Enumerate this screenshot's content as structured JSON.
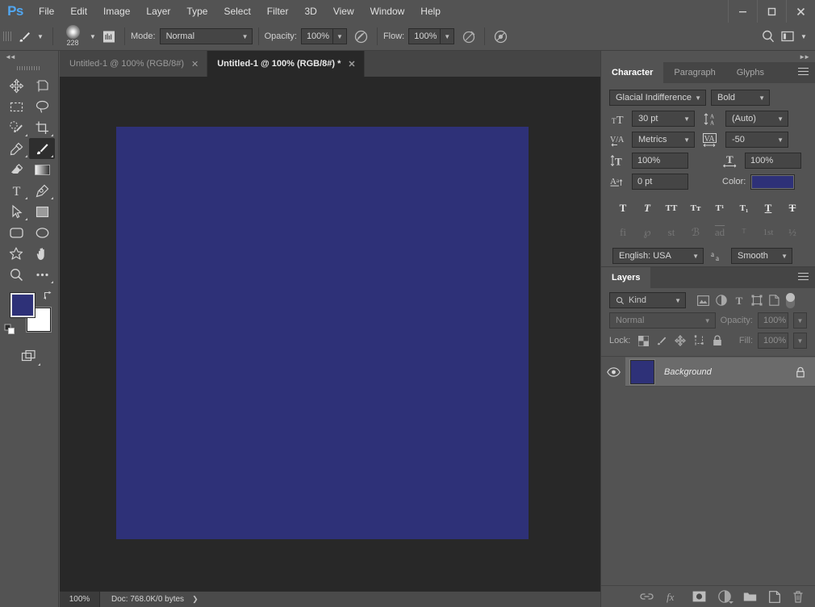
{
  "app": {
    "name": "Ps",
    "logo_color": "#51a6f0"
  },
  "menubar": {
    "items": [
      "File",
      "Edit",
      "Image",
      "Layer",
      "Type",
      "Select",
      "Filter",
      "3D",
      "View",
      "Window",
      "Help"
    ]
  },
  "window_controls": {
    "minimize": "minimize-icon",
    "maximize": "maximize-icon",
    "close": "close-icon"
  },
  "options_bar": {
    "tool_icon": "brush-tool-icon",
    "brush_size": "228",
    "brush_settings_icon": "brush-panel-icon",
    "mode_label": "Mode:",
    "mode_value": "Normal",
    "opacity_label": "Opacity:",
    "opacity_value": "100%",
    "airbrush_opacity_icon": "pressure-opacity-icon",
    "flow_label": "Flow:",
    "flow_value": "100%",
    "airbrush_icon": "airbrush-icon",
    "smoothing_icon": "pressure-size-icon",
    "search_icon": "search-icon",
    "workspace_icon": "workspace-icon"
  },
  "toolbar": {
    "collapse_icon": "collapse-panel-icon",
    "tools": [
      {
        "name": "move-tool",
        "active": false,
        "has_flyout": false
      },
      {
        "name": "artboard-tool",
        "active": false,
        "has_flyout": false
      },
      {
        "name": "rectangular-marquee-tool",
        "active": false,
        "has_flyout": false
      },
      {
        "name": "lasso-tool",
        "active": false,
        "has_flyout": false
      },
      {
        "name": "quick-selection-tool",
        "active": false,
        "has_flyout": true
      },
      {
        "name": "crop-tool",
        "active": false,
        "has_flyout": true
      },
      {
        "name": "eyedropper-tool",
        "active": false,
        "has_flyout": true
      },
      {
        "name": "brush-tool",
        "active": true,
        "has_flyout": true
      },
      {
        "name": "eraser-tool",
        "active": false,
        "has_flyout": false
      },
      {
        "name": "gradient-tool",
        "active": false,
        "has_flyout": false
      },
      {
        "name": "type-tool",
        "active": false,
        "has_flyout": true
      },
      {
        "name": "pen-tool",
        "active": false,
        "has_flyout": true
      },
      {
        "name": "path-selection-tool",
        "active": false,
        "has_flyout": true
      },
      {
        "name": "rectangle-shape-tool",
        "active": false,
        "has_flyout": false
      },
      {
        "name": "rounded-rectangle-tool",
        "active": false,
        "has_flyout": false
      },
      {
        "name": "ellipse-tool",
        "active": false,
        "has_flyout": false
      },
      {
        "name": "custom-shape-tool",
        "active": false,
        "has_flyout": false
      },
      {
        "name": "hand-tool",
        "active": false,
        "has_flyout": false
      },
      {
        "name": "zoom-tool",
        "active": false,
        "has_flyout": false
      },
      {
        "name": "edit-toolbar-tool",
        "active": false,
        "has_flyout": true
      }
    ],
    "foreground_color": "#2e3178",
    "background_color": "#ffffff",
    "swap_colors_icon": "swap-colors-icon",
    "default_colors_icon": "default-colors-icon",
    "screen_mode_icon": "screen-mode-icon"
  },
  "tabs": [
    {
      "title": "Untitled-1 @ 100% (RGB/8#)",
      "modified": false,
      "active": false
    },
    {
      "title": "Untitled-1 @ 100% (RGB/8#) *",
      "modified": true,
      "active": true
    }
  ],
  "canvas": {
    "background_color": "#282828",
    "artboard_color": "#2e3178"
  },
  "status_bar": {
    "zoom": "100%",
    "doc_info": "Doc: 768.0K/0 bytes",
    "expand_icon": "chevron-right-icon"
  },
  "dock": {
    "collapse_icon": "expand-panels-icon"
  },
  "character_panel": {
    "tabs": [
      "Character",
      "Paragraph",
      "Glyphs"
    ],
    "active_tab": "Character",
    "menu_icon": "panel-menu-icon",
    "font_family": "Glacial Indifference",
    "font_style": "Bold",
    "font_size_icon": "font-size-icon",
    "font_size": "30 pt",
    "leading_icon": "leading-icon",
    "leading": "(Auto)",
    "kerning_icon": "kerning-icon",
    "kerning": "Metrics",
    "tracking_icon": "tracking-icon",
    "tracking": "-50",
    "vertical_scale_icon": "vertical-scale-icon",
    "vertical_scale": "100%",
    "horizontal_scale_icon": "horizontal-scale-icon",
    "horizontal_scale": "100%",
    "baseline_shift_icon": "baseline-shift-icon",
    "baseline_shift": "0 pt",
    "color_label": "Color:",
    "color_value": "#2e3178",
    "style_buttons": [
      "T",
      "T",
      "TT",
      "Tт",
      "T¹",
      "T₁",
      "T",
      "T"
    ],
    "style_button_names": [
      "faux-bold",
      "faux-italic",
      "all-caps",
      "small-caps",
      "superscript",
      "subscript",
      "underline",
      "strikethrough"
    ],
    "opentype_buttons": [
      "fi",
      "℘",
      "st",
      "ℬ",
      "ad",
      "ᵀ",
      "1st",
      "½"
    ],
    "opentype_button_names": [
      "standard-ligatures",
      "contextual-alternates",
      "discretionary-ligatures",
      "swash",
      "oldstyle",
      "titling-alternates",
      "ordinals",
      "fractions"
    ],
    "language": "English: USA",
    "antialias_icon": "antialias-icon",
    "antialias": "Smooth"
  },
  "layers_panel": {
    "tabs": [
      "Layers"
    ],
    "active_tab": "Layers",
    "menu_icon": "panel-menu-icon",
    "filter_icon": "search-icon",
    "filter_kind": "Kind",
    "filter_type_icons": [
      "pixel-filter-icon",
      "adjustment-filter-icon",
      "type-filter-icon",
      "shape-filter-icon",
      "smart-object-filter-icon"
    ],
    "filter_toggle_icon": "filter-enable-toggle",
    "blend_mode": "Normal",
    "opacity_label": "Opacity:",
    "opacity_value": "100%",
    "lock_label": "Lock:",
    "lock_icons": [
      "lock-transparent-pixels-icon",
      "lock-image-pixels-icon",
      "lock-position-icon",
      "lock-artboard-nesting-icon",
      "lock-all-icon"
    ],
    "fill_label": "Fill:",
    "fill_value": "100%",
    "layers": [
      {
        "name": "Background",
        "visible": true,
        "locked": true,
        "selected": true,
        "thumb_color": "#2e3178",
        "visibility_icon": "eye-icon",
        "lock_icon": "lock-icon"
      }
    ],
    "footer_icons": [
      "link-layers-icon",
      "layer-style-fx-icon",
      "add-layer-mask-icon",
      "new-adjustment-layer-icon",
      "new-group-icon",
      "new-layer-icon",
      "delete-layer-icon"
    ]
  }
}
